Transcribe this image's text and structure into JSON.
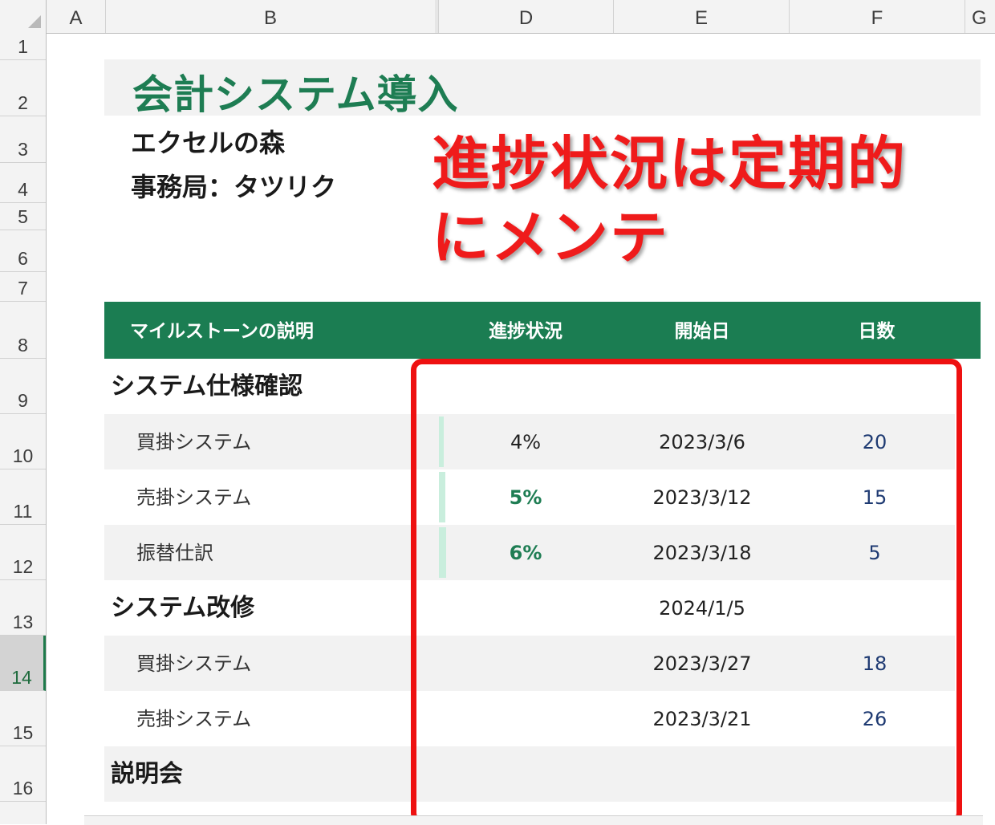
{
  "columns": [
    "A",
    "B",
    "D",
    "E",
    "F",
    "G"
  ],
  "rows": [
    "1",
    "2",
    "3",
    "4",
    "5",
    "6",
    "7",
    "8",
    "9",
    "10",
    "11",
    "12",
    "13",
    "14",
    "15",
    "16"
  ],
  "active_row": "14",
  "sheet": {
    "title": "会計システム導入",
    "company": "エクセルの森",
    "office": "事務局：タツリク"
  },
  "callout": "進捗状況は定期的にメンテ",
  "table": {
    "headers": {
      "description": "マイルストーンの説明",
      "progress": "進捗状況",
      "start": "開始日",
      "days": "日数"
    },
    "rows": [
      {
        "kind": "section",
        "label": "システム仕様確認",
        "progress": "",
        "start": "",
        "days": ""
      },
      {
        "kind": "item",
        "label": "買掛システム",
        "progress": "4%",
        "progress_value": 0.04,
        "progress_bold": false,
        "start": "2023/3/6",
        "days": "20"
      },
      {
        "kind": "item",
        "label": "売掛システム",
        "progress": "5%",
        "progress_value": 0.05,
        "progress_bold": true,
        "start": "2023/3/12",
        "days": "15"
      },
      {
        "kind": "item",
        "label": "振替仕訳",
        "progress": "6%",
        "progress_value": 0.06,
        "progress_bold": true,
        "start": "2023/3/18",
        "days": "5"
      },
      {
        "kind": "section",
        "label": "システム改修",
        "progress": "",
        "start": "2024/1/5",
        "days": ""
      },
      {
        "kind": "item",
        "label": "買掛システム",
        "progress": "",
        "start": "2023/3/27",
        "days": "18"
      },
      {
        "kind": "item",
        "label": "売掛システム",
        "progress": "",
        "start": "2023/3/21",
        "days": "26"
      },
      {
        "kind": "section",
        "label": "説明会",
        "progress": "",
        "start": "",
        "days": ""
      }
    ]
  },
  "colors": {
    "accent_green": "#1b7d52",
    "callout_red": "#ef1b1b",
    "databar": "#c9eedd"
  }
}
